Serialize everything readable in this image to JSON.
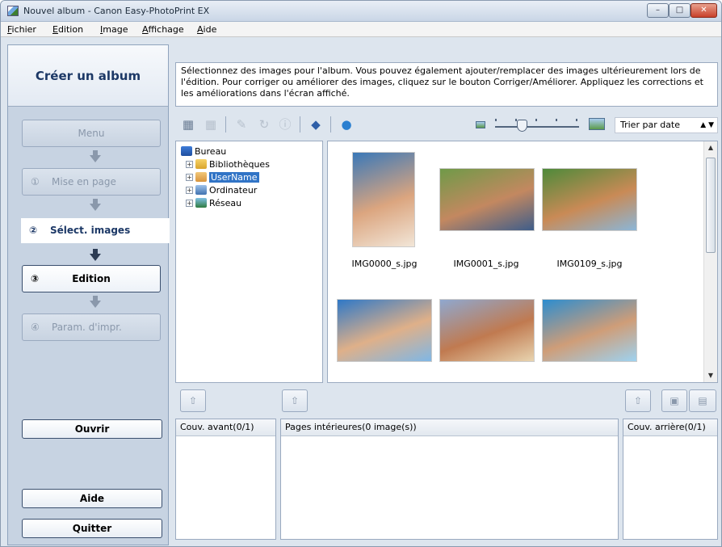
{
  "window": {
    "title": "Nouvel album - Canon Easy-PhotoPrint EX",
    "controls": {
      "minimize": "–",
      "maximize": "□",
      "close": "✕"
    }
  },
  "menu": [
    "Fichier",
    "Edition",
    "Image",
    "Affichage",
    "Aide"
  ],
  "sidebar": {
    "title": "Créer un album",
    "menu_label": "Menu",
    "steps": [
      {
        "num": "①",
        "label": "Mise en page",
        "state": "disabled"
      },
      {
        "num": "②",
        "label": "Sélect. images",
        "state": "current"
      },
      {
        "num": "③",
        "label": "Edition",
        "state": "active"
      },
      {
        "num": "④",
        "label": "Param. d'impr.",
        "state": "disabled"
      }
    ],
    "open_label": "Ouvrir",
    "help_label": "Aide",
    "quit_label": "Quitter"
  },
  "instruction": "Sélectionnez des images pour l'album. Vous pouvez également ajouter/remplacer des images ultérieurement lors de l'édition. Pour corriger ou améliorer des images, cliquez sur le bouton Corriger/Améliorer. Appliquez les corrections et les améliorations dans l'écran affiché.",
  "toolbar": {
    "icons": [
      "select-all-icon",
      "deselect-all-icon",
      "correct-enhance-icon",
      "rotate-icon",
      "image-info-icon",
      "photo-editing-icon",
      "online-icon"
    ],
    "sort": {
      "label": "Trier par date",
      "caret": "▲ ▼"
    },
    "zoom_level": 0.3
  },
  "tree": {
    "root": "Bureau",
    "items": [
      {
        "label": "Bibliothèques",
        "icon": "library-folder-icon"
      },
      {
        "label": "UserName",
        "icon": "user-folder-icon",
        "selected": true
      },
      {
        "label": "Ordinateur",
        "icon": "computer-icon"
      },
      {
        "label": "Réseau",
        "icon": "network-icon"
      }
    ],
    "expander": "+"
  },
  "thumbnails": [
    {
      "name": "IMG0000_s.jpg",
      "colors": [
        "#3a78b8",
        "#dba57f",
        "#f2e6d8"
      ]
    },
    {
      "name": "IMG0001_s.jpg",
      "colors": [
        "#6f9a48",
        "#c38860",
        "#3e5d8a"
      ]
    },
    {
      "name": "IMG0109_s.jpg",
      "colors": [
        "#4e8a3a",
        "#c98a56",
        "#8bb6d8"
      ]
    },
    {
      "name": "",
      "colors": [
        "#2f78c7",
        "#dfb089",
        "#7fb7e6"
      ]
    },
    {
      "name": "",
      "colors": [
        "#8fa8cf",
        "#c07a50",
        "#e8d4b0"
      ]
    },
    {
      "name": "",
      "colors": [
        "#2d8dcf",
        "#cf9d78",
        "#9ed2f0"
      ]
    }
  ],
  "album": {
    "front_cover": "Couv. avant(0/1)",
    "inner_pages": "Pages intérieures(0 image(s))",
    "back_cover": "Couv. arrière(0/1)"
  }
}
